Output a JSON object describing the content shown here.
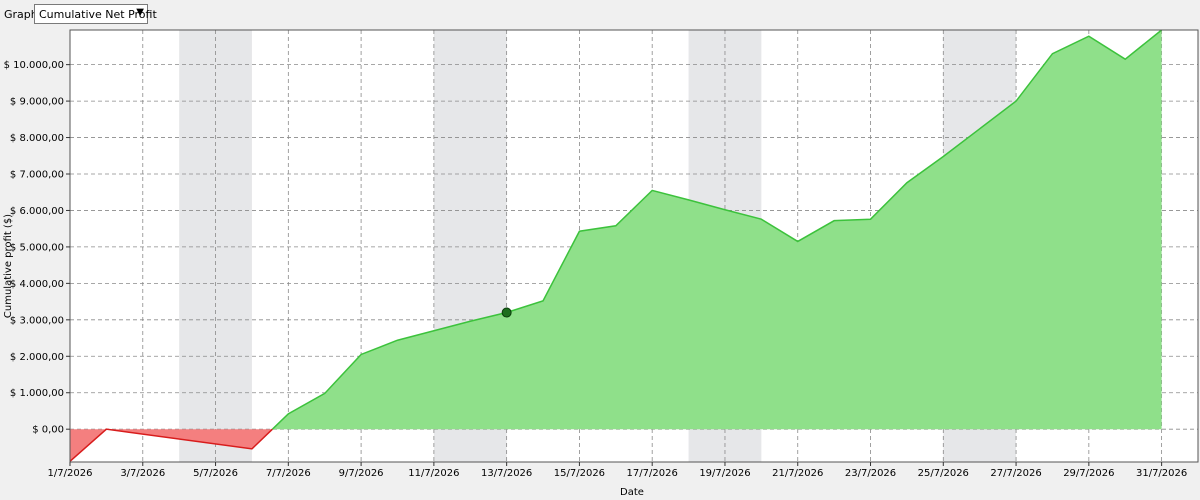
{
  "toolbar": {
    "graph_label": "Graph",
    "graph_select_value": "Cumulative Net Profit",
    "caret_icon": "chevron-down-icon"
  },
  "colors": {
    "positive_fill": "#8fe08a",
    "positive_line": "#3cc23c",
    "negative_fill": "#f47f7f",
    "negative_line": "#d81c1c",
    "shaded_band": "#e6e7e9",
    "grid": "#8a8a8a",
    "marker": "#1e6e1e"
  },
  "chart_data": {
    "type": "area",
    "xlabel": "Date",
    "ylabel": "Cumulative profit ($)",
    "x_ticks": [
      "1/7/2026",
      "3/7/2026",
      "5/7/2026",
      "7/7/2026",
      "9/7/2026",
      "11/7/2026",
      "13/7/2026",
      "15/7/2026",
      "17/7/2026",
      "19/7/2026",
      "21/7/2026",
      "23/7/2026",
      "25/7/2026",
      "27/7/2026",
      "29/7/2026",
      "31/7/2026"
    ],
    "y_ticks": [
      "$ 0,00",
      "$ 1.000,00",
      "$ 2.000,00",
      "$ 3.000,00",
      "$ 4.000,00",
      "$ 5.000,00",
      "$ 6.000,00",
      "$ 7.000,00",
      "$ 8.000,00",
      "$ 9.000,00",
      "$ 10.000,00"
    ],
    "y_tick_values": [
      0,
      1000,
      2000,
      3000,
      4000,
      5000,
      6000,
      7000,
      8000,
      9000,
      10000
    ],
    "ylim": [
      -900,
      10950
    ],
    "xlim": [
      "1/7/2026",
      "1/8/2026"
    ],
    "grid": true,
    "shaded_weekend_bands": true,
    "highlight_point": {
      "x": "13/7/2026",
      "y": 3200
    },
    "series": [
      {
        "points": [
          {
            "x": "1/7/2026",
            "y": -880
          },
          {
            "x": "2/7/2026",
            "y": 0
          },
          {
            "x": "6/7/2026",
            "y": -540
          },
          {
            "x": "7/7/2026",
            "y": 420
          },
          {
            "x": "8/7/2026",
            "y": 980
          },
          {
            "x": "9/7/2026",
            "y": 2050
          },
          {
            "x": "10/7/2026",
            "y": 2440
          },
          {
            "x": "11/7/2026",
            "y": 2700
          },
          {
            "x": "12/7/2026",
            "y": 2960
          },
          {
            "x": "13/7/2026",
            "y": 3200
          },
          {
            "x": "14/7/2026",
            "y": 3520
          },
          {
            "x": "15/7/2026",
            "y": 5430
          },
          {
            "x": "16/7/2026",
            "y": 5580
          },
          {
            "x": "17/7/2026",
            "y": 6550
          },
          {
            "x": "18/7/2026",
            "y": 6290
          },
          {
            "x": "19/7/2026",
            "y": 6020
          },
          {
            "x": "20/7/2026",
            "y": 5760
          },
          {
            "x": "21/7/2026",
            "y": 5150
          },
          {
            "x": "22/7/2026",
            "y": 5720
          },
          {
            "x": "23/7/2026",
            "y": 5760
          },
          {
            "x": "24/7/2026",
            "y": 6760
          },
          {
            "x": "25/7/2026",
            "y": 7480
          },
          {
            "x": "26/7/2026",
            "y": 8240
          },
          {
            "x": "27/7/2026",
            "y": 9000
          },
          {
            "x": "28/7/2026",
            "y": 10300
          },
          {
            "x": "29/7/2026",
            "y": 10780
          },
          {
            "x": "30/7/2026",
            "y": 10150
          },
          {
            "x": "31/7/2026",
            "y": 10950
          }
        ]
      }
    ]
  }
}
